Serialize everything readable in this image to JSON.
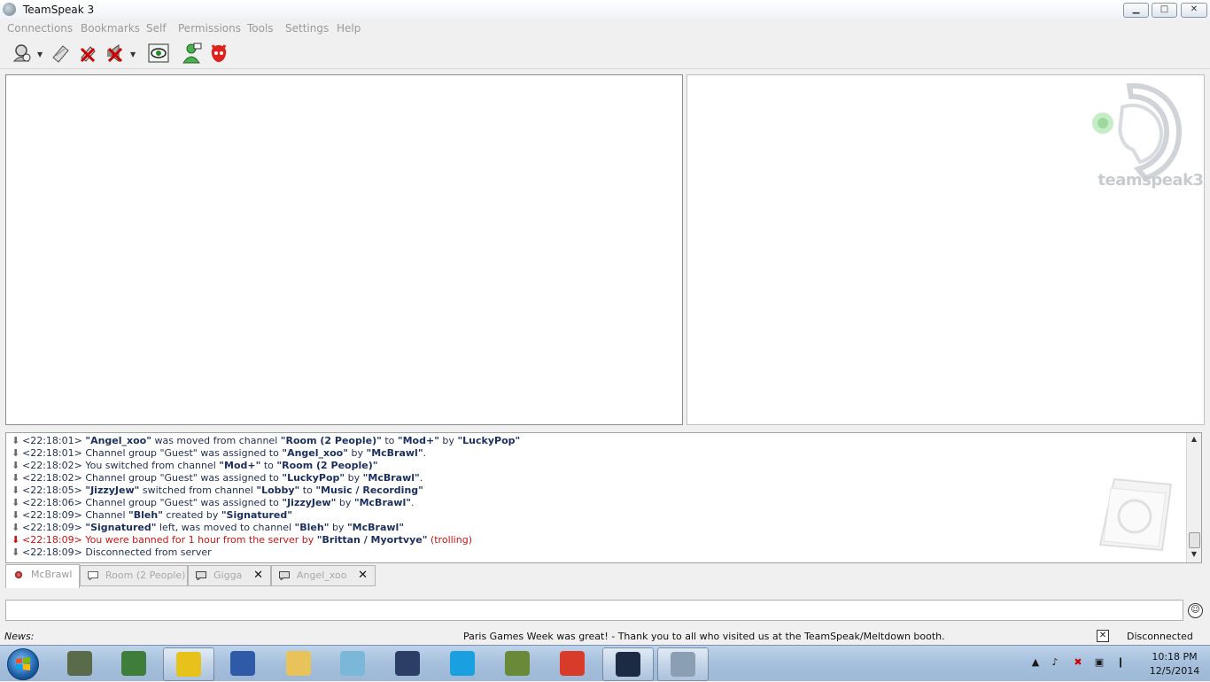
{
  "window": {
    "title": "TeamSpeak 3",
    "minimize": "▁",
    "maximize": "□",
    "close": "✕"
  },
  "menu": [
    "Connections",
    "Bookmarks",
    "Self",
    "Permissions",
    "Tools",
    "Settings",
    "Help"
  ],
  "toolbar": {
    "icons": [
      "connect-icon",
      "disconnect-icon",
      "mute-microphone-icon",
      "mute-speakers-icon",
      "subscribe-channel-icon",
      "away-status-icon",
      "clear-log-icon"
    ],
    "dropdown_arrow": "▼"
  },
  "branding": {
    "wordmark": "teamspeak3"
  },
  "log": [
    {
      "time": "<22:18:01>",
      "parts": [
        {
          "t": "\"Angel_xoo\"",
          "b": true
        },
        {
          "t": " was moved from channel ",
          "b": false
        },
        {
          "t": "\"Room (2 People)\"",
          "b": true
        },
        {
          "t": " to ",
          "b": false
        },
        {
          "t": "\"Mod+\"",
          "b": true
        },
        {
          "t": " by ",
          "b": false
        },
        {
          "t": "\"LuckyPop\"",
          "b": true
        }
      ]
    },
    {
      "time": "<22:18:01>",
      "parts": [
        {
          "t": "Channel group \"Guest\" was assigned to ",
          "b": false
        },
        {
          "t": "\"Angel_xoo\"",
          "b": true
        },
        {
          "t": " by ",
          "b": false
        },
        {
          "t": "\"McBrawl\"",
          "b": true
        },
        {
          "t": ".",
          "b": false
        }
      ]
    },
    {
      "time": "<22:18:02>",
      "parts": [
        {
          "t": "You switched from channel ",
          "b": false
        },
        {
          "t": "\"Mod+\"",
          "b": true
        },
        {
          "t": " to ",
          "b": false
        },
        {
          "t": "\"Room (2 People)\"",
          "b": true
        }
      ]
    },
    {
      "time": "<22:18:02>",
      "parts": [
        {
          "t": "Channel group \"Guest\" was assigned to ",
          "b": false
        },
        {
          "t": "\"LuckyPop\"",
          "b": true
        },
        {
          "t": " by ",
          "b": false
        },
        {
          "t": "\"McBrawl\"",
          "b": true
        },
        {
          "t": ".",
          "b": false
        }
      ]
    },
    {
      "time": "<22:18:05>",
      "parts": [
        {
          "t": "\"JizzyJew\"",
          "b": true
        },
        {
          "t": " switched from channel ",
          "b": false
        },
        {
          "t": "\"Lobby\"",
          "b": true
        },
        {
          "t": " to ",
          "b": false
        },
        {
          "t": "\"Music / Recording\"",
          "b": true
        }
      ]
    },
    {
      "time": "<22:18:06>",
      "parts": [
        {
          "t": "Channel group \"Guest\" was assigned to ",
          "b": false
        },
        {
          "t": "\"JizzyJew\"",
          "b": true
        },
        {
          "t": " by ",
          "b": false
        },
        {
          "t": "\"McBrawl\"",
          "b": true
        },
        {
          "t": ".",
          "b": false
        }
      ]
    },
    {
      "time": "<22:18:09>",
      "parts": [
        {
          "t": "Channel ",
          "b": false
        },
        {
          "t": "\"Bleh\"",
          "b": true
        },
        {
          "t": " created by ",
          "b": false
        },
        {
          "t": "\"Signatured\"",
          "b": true
        }
      ]
    },
    {
      "time": "<22:18:09>",
      "parts": [
        {
          "t": "\"Signatured\"",
          "b": true
        },
        {
          "t": " left, was moved to channel ",
          "b": false
        },
        {
          "t": "\"Bleh\"",
          "b": true
        },
        {
          "t": " by ",
          "b": false
        },
        {
          "t": "\"McBrawl\"",
          "b": true
        }
      ]
    },
    {
      "time": "<22:18:09>",
      "kind": "ban",
      "parts": [
        {
          "t": "You were banned for 1 hour from the server by ",
          "b": false
        },
        {
          "t": "\"Brittan / Myortvye\"",
          "b": true
        },
        {
          "t": " (trolling)",
          "b": false
        }
      ]
    },
    {
      "time": "<22:18:09>",
      "parts": [
        {
          "t": "Disconnected from server",
          "b": false
        }
      ]
    }
  ],
  "tabs": [
    {
      "label": "McBrawl",
      "active": true,
      "closable": false,
      "icon": "server-icon"
    },
    {
      "label": "Room (2 People)",
      "active": false,
      "closable": false,
      "icon": "channel-chat-icon"
    },
    {
      "label": "Gigga",
      "active": false,
      "closable": true,
      "icon": "private-chat-icon"
    },
    {
      "label": "Angel_xoo",
      "active": false,
      "closable": true,
      "icon": "private-chat-icon"
    }
  ],
  "tab_close": "✕",
  "emoji": "☺",
  "news": {
    "label": "News:",
    "text": "Paris Games Week was great! - Thank you to all who visited us at the TeamSpeak/Meltdown booth.",
    "close": "✕"
  },
  "status": "Disconnected",
  "taskbar": {
    "apps": [
      {
        "name": "taskbar-app-terminal",
        "open": false,
        "color": "#5a6b4a"
      },
      {
        "name": "taskbar-app-monitor",
        "open": false,
        "color": "#3f7d3a"
      },
      {
        "name": "taskbar-app-shield",
        "open": true,
        "color": "#e6c21a"
      },
      {
        "name": "taskbar-app-notepad",
        "open": false,
        "color": "#2e5aa8"
      },
      {
        "name": "taskbar-app-explorer",
        "open": false,
        "color": "#e8c35a"
      },
      {
        "name": "taskbar-app-notes",
        "open": false,
        "color": "#7bb7d8"
      },
      {
        "name": "taskbar-app-video",
        "open": false,
        "color": "#2c3e66"
      },
      {
        "name": "taskbar-app-skype",
        "open": false,
        "color": "#1aa0e0"
      },
      {
        "name": "taskbar-app-minecraft",
        "open": false,
        "color": "#6a8a3a"
      },
      {
        "name": "taskbar-app-chrome",
        "open": false,
        "color": "#d93b2b"
      },
      {
        "name": "taskbar-app-windows",
        "open": true,
        "color": "#1d2a44"
      },
      {
        "name": "taskbar-app-teamspeak",
        "open": true,
        "color": "#8aa0b2"
      }
    ],
    "clock_time": "10:18 PM",
    "clock_date": "12/5/2014",
    "tray": [
      "▲",
      "♪",
      "✖",
      "▣",
      "❙"
    ]
  },
  "colors": {
    "ban_red": "#cc1111",
    "nick_navy": "#1a2f5f",
    "menu_disabled": "#9a9a9a"
  }
}
